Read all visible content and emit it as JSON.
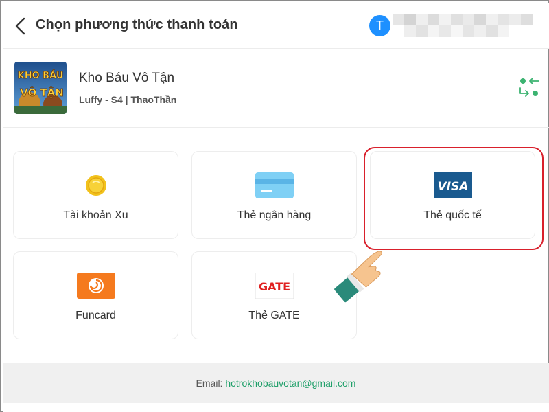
{
  "header": {
    "title": "Chọn phương thức thanh toán",
    "avatar_letter": "T"
  },
  "game": {
    "name": "Kho Báu Vô Tận",
    "server": "Luffy - S4 | ThaoThần",
    "thumb_text_top": "KHO BÁU",
    "thumb_text_bottom": "VÔ TẬN"
  },
  "methods": [
    {
      "label": "Tài khoản Xu",
      "icon": "coin-icon"
    },
    {
      "label": "Thẻ ngân hàng",
      "icon": "bank-card-icon"
    },
    {
      "label": "Thẻ quốc tế",
      "icon": "visa-icon",
      "icon_text": "VISA",
      "selected": true
    },
    {
      "label": "Funcard",
      "icon": "funcard-icon"
    },
    {
      "label": "Thẻ GATE",
      "icon": "gate-icon",
      "icon_text": "GATE"
    }
  ],
  "footer": {
    "email_label": "Email:",
    "email": "hotrokhobauvotan@gmail.com"
  },
  "colors": {
    "accent_green": "#20a06a",
    "avatar_blue": "#1e90ff",
    "highlight_red": "#d9202c",
    "visa_blue": "#1a5a8f"
  }
}
